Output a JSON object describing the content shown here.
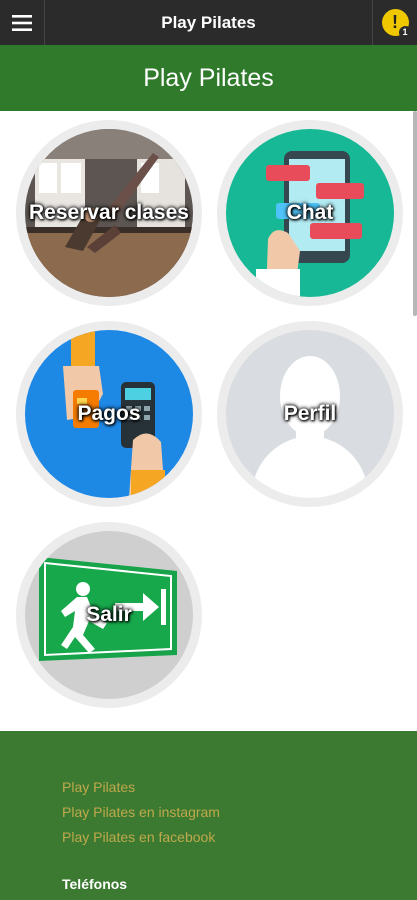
{
  "topbar": {
    "title": "Play Pilates",
    "menu_icon": "hamburger-menu-icon",
    "notification_icon": "warning-exclamation-icon",
    "notification_symbol": "!",
    "notification_count": "1",
    "notification_color": "#f0c800"
  },
  "header": {
    "title": "Play Pilates",
    "background": "#2f7a2b"
  },
  "tiles": [
    {
      "label": "Reservar clases",
      "icon": "pilates-class-image"
    },
    {
      "label": "Chat",
      "icon": "chat-phone-image"
    },
    {
      "label": "Pagos",
      "icon": "payment-card-image"
    },
    {
      "label": "Perfil",
      "icon": "profile-silhouette-image"
    },
    {
      "label": "Salir",
      "icon": "exit-sign-image"
    }
  ],
  "footer": {
    "links": [
      "Play Pilates",
      "Play Pilates en instagram",
      "Play Pilates en facebook"
    ],
    "phones_label": "Teléfonos",
    "background": "#3c7a32",
    "link_color": "#bfa84b"
  }
}
